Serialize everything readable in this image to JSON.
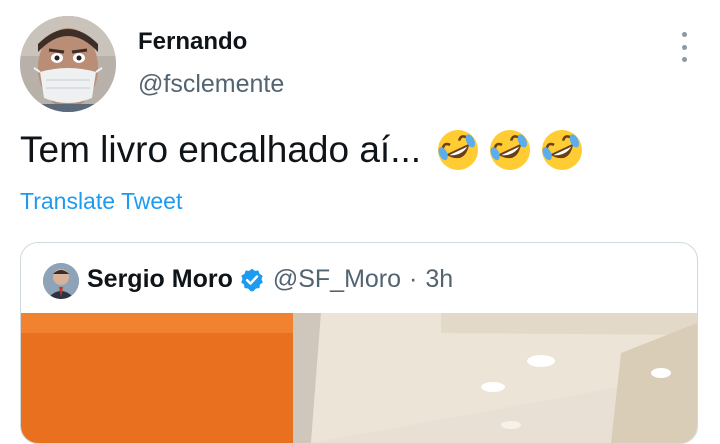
{
  "tweet": {
    "author": {
      "display_name": "Fernando",
      "handle": "@fsclemente",
      "avatar_icon": "avatar-masked-man"
    },
    "text": "Tem livro encalhado aí...",
    "emojis": [
      "rolling-on-the-floor-laughing",
      "rolling-on-the-floor-laughing",
      "rolling-on-the-floor-laughing"
    ],
    "translate_label": "Translate Tweet",
    "more_icon": "more-vertical-icon"
  },
  "quoted_tweet": {
    "author": {
      "display_name": "Sergio Moro",
      "handle": "@SF_Moro",
      "verified": true,
      "avatar_icon": "avatar-man-suit"
    },
    "separator": "·",
    "time": "3h",
    "media": "photo-orange-wall-ceiling-lights"
  },
  "colors": {
    "link_blue": "#1d9bf0",
    "secondary_text": "#536471",
    "border": "#cfd9de",
    "verified_badge": "#1d9bf0"
  }
}
